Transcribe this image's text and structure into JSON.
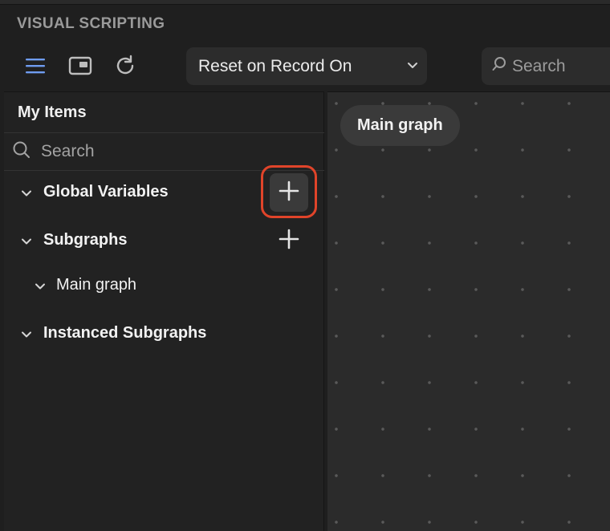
{
  "app": {
    "title": "VISUAL SCRIPTING"
  },
  "toolbar": {
    "menu_icon": "hamburger-menu-icon",
    "layout_icon": "picture-in-picture-icon",
    "refresh_icon": "refresh-icon",
    "mode_dropdown": {
      "selected": "Reset on Record On"
    },
    "search": {
      "placeholder": "Search"
    }
  },
  "panel": {
    "title": "My Items",
    "search": {
      "placeholder": "Search"
    },
    "tree": [
      {
        "label": "Global Variables",
        "expanded": true,
        "has_add": true
      },
      {
        "label": "Subgraphs",
        "expanded": true,
        "has_add": true
      },
      {
        "label": "Main graph",
        "expanded": true,
        "child": true
      },
      {
        "label": "Instanced Subgraphs",
        "expanded": true,
        "has_add": false
      }
    ]
  },
  "canvas": {
    "graph_name": "Main graph"
  },
  "colors": {
    "accent": "#6f9cf0",
    "highlight": "#e0442a",
    "background": "#1f1f1f",
    "canvas": "#2b2b2b"
  }
}
